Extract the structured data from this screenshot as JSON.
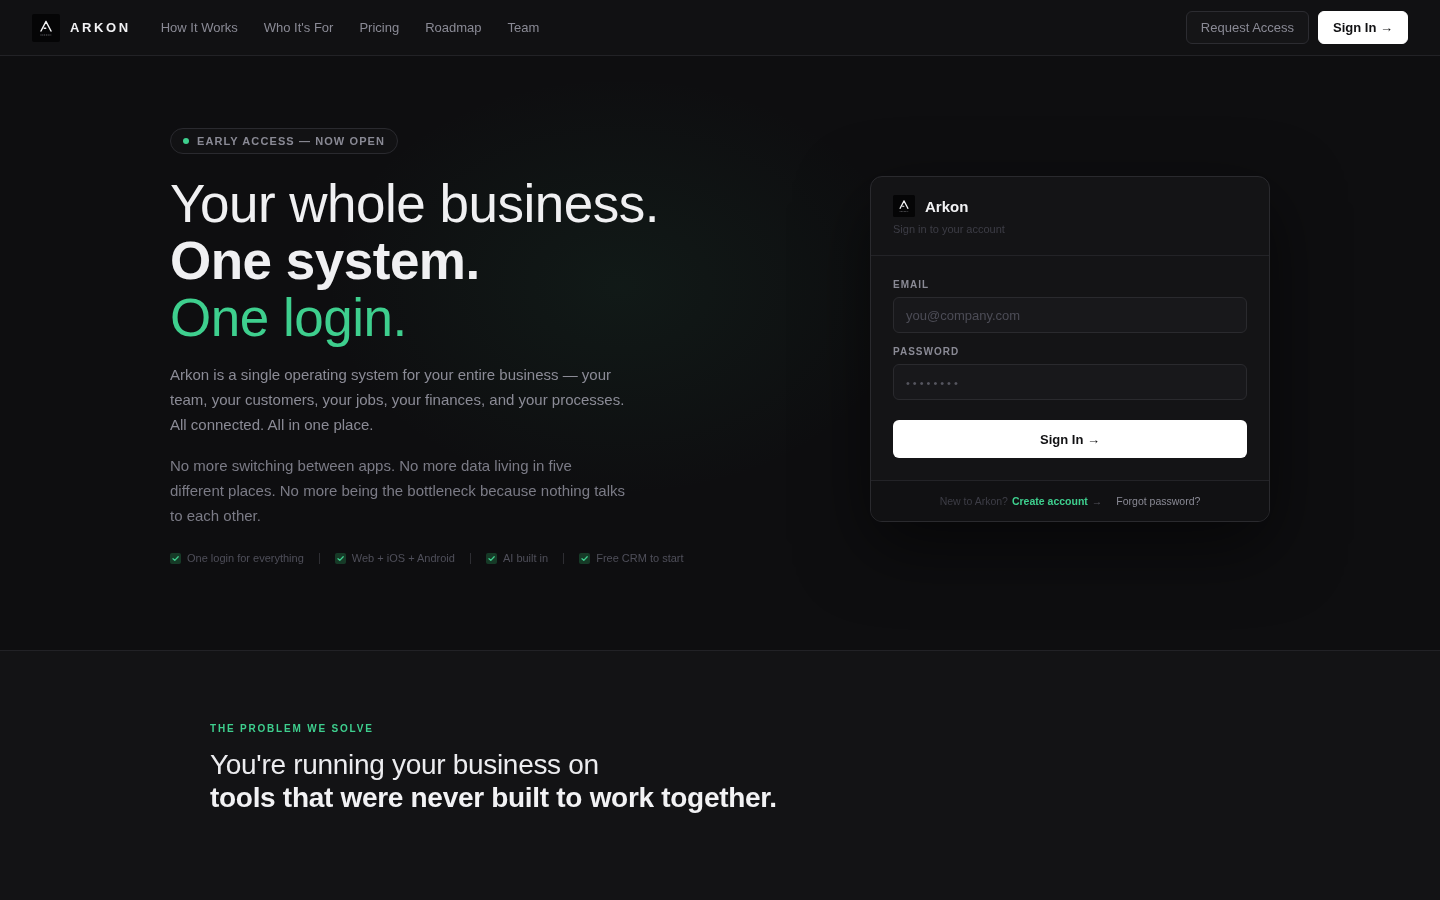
{
  "nav": {
    "brand": "ARKON",
    "links": [
      "How It Works",
      "Who It's For",
      "Pricing",
      "Roadmap",
      "Team"
    ],
    "actions": [
      {
        "label": "Request Access",
        "kind": "secondary"
      },
      {
        "label": "Sign In →",
        "kind": "primary"
      }
    ]
  },
  "hero": {
    "badge": "EARLY ACCESS — NOW OPEN",
    "headline": [
      {
        "text": "Your whole business.",
        "kind": "light"
      },
      {
        "text": "One system.",
        "kind": "bold"
      },
      {
        "text": "One login.",
        "kind": "accent"
      }
    ],
    "paragraphs": [
      "Arkon is a single operating system for your entire business — your team, your customers, your jobs, your finances, and your processes. All connected. All in one place.",
      "No more switching between apps. No more data living in five different places. No more being the bottleneck because nothing talks to each other."
    ],
    "features": [
      {
        "label": "One login for everything",
        "checked": true
      },
      {
        "label": "Web + iOS + Android",
        "checked": true
      },
      {
        "label": "AI built in",
        "checked": true
      },
      {
        "label": "Free CRM to start",
        "checked": true
      }
    ]
  },
  "login_card": {
    "brand": "Arkon",
    "subtitle": "Sign in to your account",
    "fields": [
      {
        "label": "EMAIL",
        "placeholder": "you@company.com",
        "kind": "email"
      },
      {
        "label": "PASSWORD",
        "placeholder": "••••••••",
        "kind": "password"
      }
    ],
    "submit": "Sign In →",
    "footer": {
      "prompt": "New to Arkon?",
      "link": "Create account",
      "link_arrow": "→",
      "forgot": "Forgot password?"
    }
  },
  "problem": {
    "eyebrow": "THE PROBLEM WE SOLVE",
    "heading": "You're running your business on **tools that were never built to work together.**"
  }
}
